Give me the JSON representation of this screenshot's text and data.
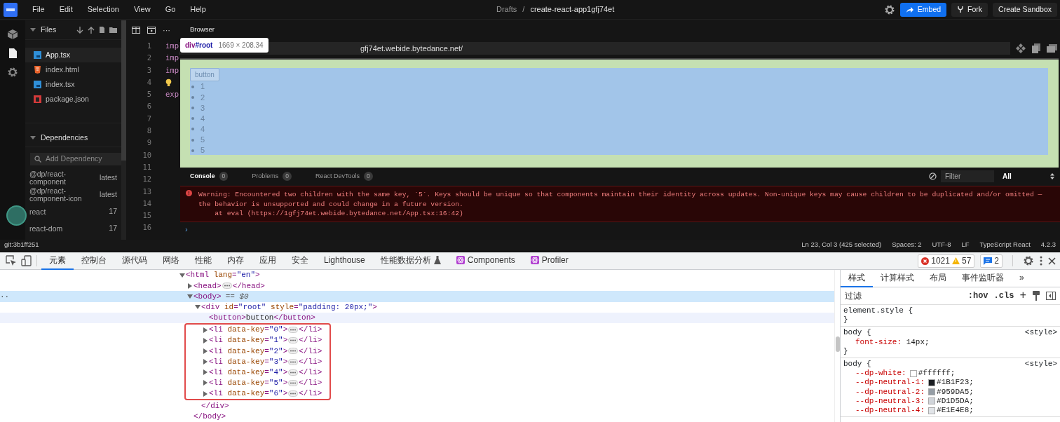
{
  "menubar": {
    "menus": [
      "File",
      "Edit",
      "Selection",
      "View",
      "Go",
      "Help"
    ],
    "breadcrumb": [
      "Drafts",
      "/",
      "create-react-app1gfj74et"
    ],
    "buttons": [
      {
        "label": "Embed",
        "kind": "primary"
      },
      {
        "label": "Fork",
        "kind": "fork"
      },
      {
        "label": "Create Sandbox",
        "kind": "plain"
      }
    ]
  },
  "activity_bar": [
    {
      "kind": "cube",
      "selected": false
    },
    {
      "kind": "file",
      "selected": true
    },
    {
      "kind": "gear",
      "selected": false
    }
  ],
  "files": {
    "title": "Files",
    "expanded": true,
    "items": [
      {
        "name": "App.tsx",
        "kind": "tsx",
        "selected": true
      },
      {
        "name": "index.html",
        "kind": "html",
        "selected": false
      },
      {
        "name": "index.tsx",
        "kind": "tsx",
        "selected": false
      },
      {
        "name": "package.json",
        "kind": "json",
        "selected": false
      }
    ]
  },
  "dependencies": {
    "title": "Dependencies",
    "expanded": true,
    "search_placeholder": "Add Dependency",
    "items": [
      {
        "name": "@dp/react-component",
        "version": "latest"
      },
      {
        "name": "@dp/react-component-icon",
        "version": "latest"
      },
      {
        "name": "react",
        "version": "17"
      },
      {
        "name": "react-dom",
        "version": "17"
      }
    ]
  },
  "editor": {
    "more": "···",
    "line_numbers": [
      "1",
      "2",
      "3",
      "4",
      "5",
      "6",
      "7",
      "8",
      "9",
      "10",
      "11",
      "12",
      "13",
      "14",
      "15",
      "16"
    ],
    "code": [
      {
        "text": "imp",
        "lightbulb": false
      },
      {
        "text": "imp",
        "lightbulb": false
      },
      {
        "text": "imp",
        "lightbulb": false
      },
      {
        "lightbulb": true
      },
      {
        "text": "exp",
        "lightbulb": false
      }
    ]
  },
  "browser": {
    "tab": "Browser",
    "url": "gfj74et.webide.bytedance.net/",
    "tooltip": {
      "tag": "div",
      "id": "#root",
      "size": "1669 × 208.34"
    },
    "preview": {
      "button": "button",
      "items": [
        "1",
        "2",
        "3",
        "4",
        "4",
        "5",
        "5"
      ]
    }
  },
  "console": {
    "tabs": [
      {
        "label": "Console",
        "count": "0",
        "selected": true
      },
      {
        "label": "Problems",
        "count": "0",
        "selected": false
      },
      {
        "label": "React DevTools",
        "count": "0",
        "selected": false
      }
    ],
    "filter_placeholder": "Filter",
    "level": "All",
    "messages": [
      {
        "kind": "error",
        "lines": [
          "Warning: Encountered two children with the same key, `5`. Keys should be unique so that components maintain their identity across updates. Non-unique keys may cause children to be duplicated and/or omitted — the behavior is unsupported and could change in a future version.",
          "    at eval (https://1gfj74et.webide.bytedance.net/App.tsx:16:42)"
        ]
      }
    ],
    "prompt": "›"
  },
  "status_bar": {
    "branch": "git:3b1ff251",
    "items": [
      "Ln 23, Col 3 (425 selected)",
      "Spaces: 2",
      "UTF-8",
      "LF",
      "TypeScript React",
      "4.2.3"
    ]
  },
  "devtools": {
    "tabs": [
      {
        "label": "元素",
        "kind": "plain",
        "selected": true
      },
      {
        "label": "控制台",
        "kind": "plain",
        "selected": false
      },
      {
        "label": "源代码",
        "kind": "plain",
        "selected": false
      },
      {
        "label": "网络",
        "kind": "plain",
        "selected": false
      },
      {
        "label": "性能",
        "kind": "plain",
        "selected": false
      },
      {
        "label": "内存",
        "kind": "plain",
        "selected": false
      },
      {
        "label": "应用",
        "kind": "plain",
        "selected": false
      },
      {
        "label": "安全",
        "kind": "plain",
        "selected": false
      },
      {
        "label": "Lighthouse",
        "kind": "plain",
        "selected": false
      },
      {
        "label": "性能数据分析",
        "kind": "flask",
        "selected": false
      },
      {
        "label": "Components",
        "kind": "react",
        "selected": false
      },
      {
        "label": "Profiler",
        "kind": "react",
        "selected": false
      }
    ],
    "errors": "1021",
    "warnings": "57",
    "messages": "2",
    "dom": [
      {
        "open": "<html lang=\"en\">",
        "expanded": true,
        "selected": false,
        "hovered": false,
        "boxed": false,
        "children": [
          {
            "open": "<head>",
            "expanded": false,
            "close": "</head>",
            "selected": false,
            "hovered": false,
            "boxed": false
          },
          {
            "open": "<body>",
            "expanded": true,
            "selected": true,
            "hovered": false,
            "boxed": false,
            "gutter": "··",
            "note": "== *$0*",
            "close": "</body>",
            "children": [
              {
                "open": "<div id=\"root\" style=\"padding: 20px;\">",
                "expanded": true,
                "selected": false,
                "hovered": false,
                "boxed": false,
                "close": "</div>",
                "children": [
                  {
                    "open": "<button>button</button>",
                    "selected": false,
                    "hovered": true,
                    "boxed": false
                  },
                  {
                    "open": "<li data-key=\"0\">",
                    "expanded": false,
                    "close": "</li>",
                    "selected": false,
                    "hovered": false,
                    "boxed": true
                  },
                  {
                    "open": "<li data-key=\"1\">",
                    "expanded": false,
                    "close": "</li>",
                    "selected": false,
                    "hovered": false,
                    "boxed": true
                  },
                  {
                    "open": "<li data-key=\"2\">",
                    "expanded": false,
                    "close": "</li>",
                    "selected": false,
                    "hovered": false,
                    "boxed": true
                  },
                  {
                    "open": "<li data-key=\"3\">",
                    "expanded": false,
                    "close": "</li>",
                    "selected": false,
                    "hovered": false,
                    "boxed": true
                  },
                  {
                    "open": "<li data-key=\"4\">",
                    "expanded": false,
                    "close": "</li>",
                    "selected": false,
                    "hovered": false,
                    "boxed": true
                  },
                  {
                    "open": "<li data-key=\"5\">",
                    "expanded": false,
                    "close": "</li>",
                    "selected": false,
                    "hovered": false,
                    "boxed": true
                  },
                  {
                    "open": "<li data-key=\"6\">",
                    "expanded": false,
                    "close": "</li>",
                    "selected": false,
                    "hovered": false,
                    "boxed": true
                  }
                ]
              }
            ]
          }
        ]
      }
    ],
    "styles": {
      "tabs": [
        {
          "label": "样式",
          "selected": true
        },
        {
          "label": "计算样式",
          "selected": false
        },
        {
          "label": "布局",
          "selected": false
        },
        {
          "label": "事件监听器",
          "selected": false
        }
      ],
      "more": "»",
      "filter_placeholder": "过滤",
      "hov": ":hov",
      "cls": ".cls",
      "plus": "+",
      "rules": [
        {
          "selector": "element.style {",
          "close": "}"
        },
        {
          "selector": "body {",
          "source": "<style>",
          "close": "}",
          "props": [
            {
              "name": "font-size:",
              "value": "14px;"
            }
          ]
        },
        {
          "selector": "body {",
          "source": "<style>",
          "props": [
            {
              "name": "--dp-white:",
              "value": "#ffffff;",
              "color": "#ffffff"
            },
            {
              "name": "--dp-neutral-1:",
              "value": "#1B1F23;",
              "color": "#1b1f23"
            },
            {
              "name": "--dp-neutral-2:",
              "value": "#959DA5;",
              "color": "#959da5"
            },
            {
              "name": "--dp-neutral-3:",
              "value": "#D1D5DA;",
              "color": "#d1d5da"
            },
            {
              "name": "--dp-neutral-4:",
              "value": "#E1E4E8;",
              "color": "#e1e4e8"
            }
          ]
        }
      ]
    }
  }
}
